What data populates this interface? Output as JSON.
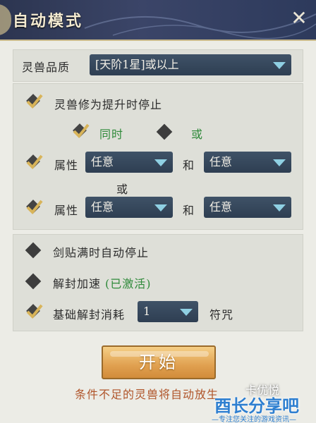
{
  "window": {
    "title": "自动模式",
    "close_glyph": "✕"
  },
  "quality": {
    "label": "灵兽品质",
    "value": "[天阶1星]或以上"
  },
  "stop_section": {
    "stop_on_upgrade_label": "灵兽修为提升时停止",
    "mode_and_label": "同时",
    "mode_or_label": "或",
    "attr_rows": [
      {
        "label": "属性",
        "first": "任意",
        "joiner": "和",
        "second": "任意"
      },
      {
        "label": "属性",
        "first": "任意",
        "joiner": "和",
        "second": "任意"
      }
    ],
    "between_rows": "或"
  },
  "extra_section": {
    "sword_full_label": "剑贴满时自动停止",
    "unseal_speed_label": "解封加速",
    "unseal_speed_status": "(已激活)",
    "base_cost_label": "基础解封消耗",
    "base_cost_value": "1",
    "base_cost_unit": "符咒"
  },
  "start": {
    "label": "开始"
  },
  "note": {
    "text": "条件不足的灵兽将自动放生"
  },
  "watermark": {
    "small": "卡优悦",
    "brand": "酉长分享吧",
    "tagline": "—专注您关注的游戏资讯—"
  },
  "colors": {
    "accent_green": "#2f8a3a",
    "dropdown_bg": "#34465b",
    "arrow": "#8fd0e3",
    "start_btn": "#e0a050"
  }
}
